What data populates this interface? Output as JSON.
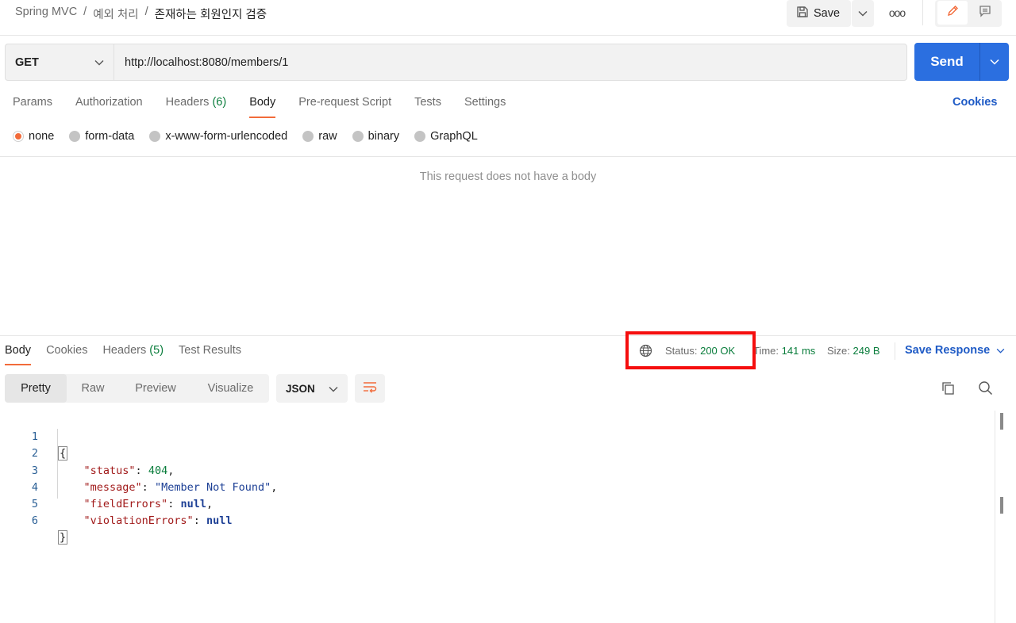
{
  "breadcrumb": {
    "collection": "Spring MVC",
    "folder": "예외 처리",
    "request": "존재하는 회원인지 검증",
    "separator": "/"
  },
  "header": {
    "save_label": "Save",
    "more_label": "ooo"
  },
  "request": {
    "method": "GET",
    "url": "http://localhost:8080/members/1",
    "send_label": "Send"
  },
  "request_tabs": {
    "params": "Params",
    "authorization": "Authorization",
    "headers": "Headers",
    "headers_count": "(6)",
    "body": "Body",
    "prerequest": "Pre-request Script",
    "tests": "Tests",
    "settings": "Settings",
    "cookies": "Cookies"
  },
  "body_types": {
    "none": "none",
    "form_data": "form-data",
    "urlencoded": "x-www-form-urlencoded",
    "raw": "raw",
    "binary": "binary",
    "graphql": "GraphQL",
    "selected": "none"
  },
  "empty_body_message": "This request does not have a body",
  "response_tabs": {
    "body": "Body",
    "cookies": "Cookies",
    "headers": "Headers",
    "headers_count": "(5)",
    "test_results": "Test Results"
  },
  "response_meta": {
    "status_label": "Status:",
    "status_value": "200 OK",
    "time_label": "Time:",
    "time_value": "141 ms",
    "size_label": "Size:",
    "size_value": "249 B",
    "save_response": "Save Response"
  },
  "view_modes": {
    "pretty": "Pretty",
    "raw": "Raw",
    "preview": "Preview",
    "visualize": "Visualize",
    "language": "JSON"
  },
  "code": {
    "line_numbers": [
      "1",
      "2",
      "3",
      "4",
      "5",
      "6"
    ],
    "open": "{",
    "close": "}",
    "status_key": "\"status\"",
    "status_value": "404",
    "message_key": "\"message\"",
    "message_value": "\"Member Not Found\"",
    "field_errors_key": "\"fieldErrors\"",
    "field_errors_value": "null",
    "violation_errors_key": "\"violationErrors\"",
    "violation_errors_value": "null"
  },
  "colors": {
    "accent": "#f26b3a",
    "primary": "#2b6fe0",
    "success": "#0a7d3c",
    "highlight": "#f50e0e"
  },
  "icons": [
    "save-icon",
    "chevron-down-icon",
    "more-icon",
    "pencil-icon",
    "comment-icon",
    "globe-icon",
    "wrap-lines-icon",
    "copy-icon",
    "search-icon"
  ]
}
